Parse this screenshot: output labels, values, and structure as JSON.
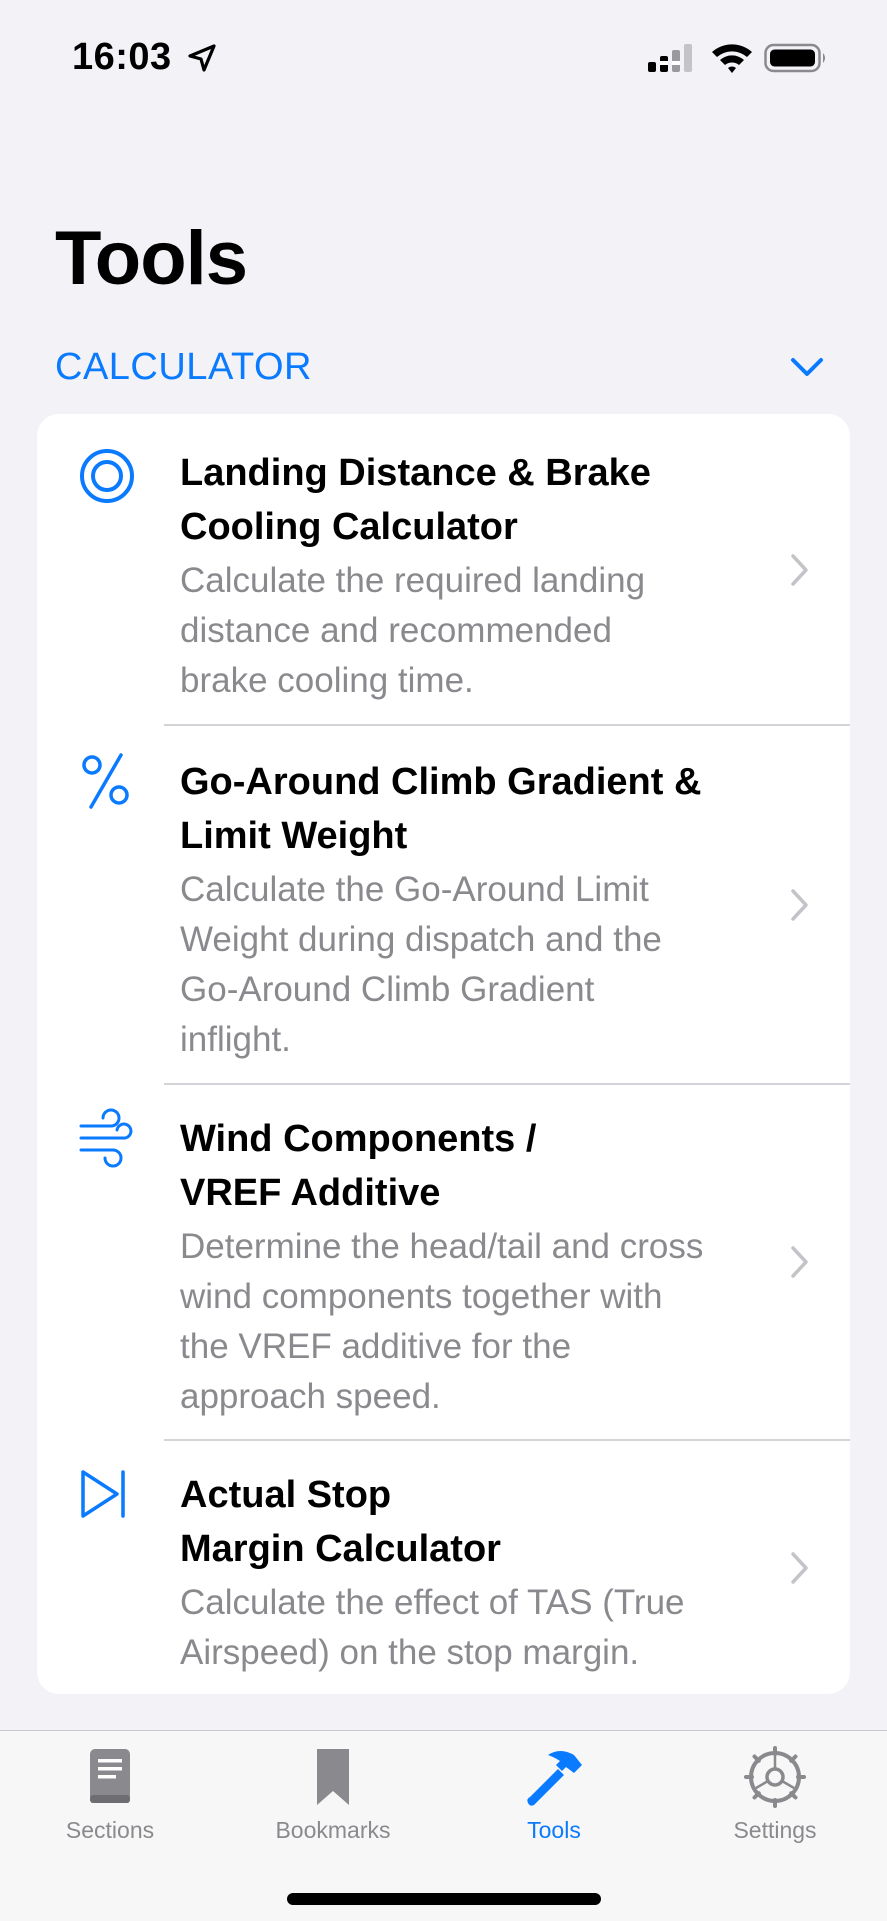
{
  "status_bar": {
    "time": "16:03"
  },
  "page": {
    "title": "Tools"
  },
  "section": {
    "title": "CALCULATOR"
  },
  "colors": {
    "accent": "#0a7aff",
    "secondary_text": "#8a8a8e",
    "background": "#f2f2f7"
  },
  "rows": [
    {
      "icon": "target-icon",
      "title_lines": [
        "Landing Distance & Brake",
        "Cooling Calculator"
      ],
      "description_lines": [
        "Calculate the required landing",
        "distance and recommended",
        "brake cooling time."
      ]
    },
    {
      "icon": "percent-icon",
      "title_lines": [
        "Go-Around Climb Gradient &",
        "Limit Weight"
      ],
      "description_lines": [
        "Calculate the Go-Around Limit",
        "Weight during dispatch and the",
        "Go-Around Climb Gradient",
        "inflight."
      ]
    },
    {
      "icon": "wind-icon",
      "title_lines": [
        "Wind Components /",
        "VREF Additive"
      ],
      "description_lines": [
        "Determine the head/tail and cross",
        "wind components together with",
        "the VREF additive for the",
        "approach speed."
      ]
    },
    {
      "icon": "play-end-icon",
      "title_lines": [
        "Actual Stop",
        "Margin Calculator"
      ],
      "description_lines": [
        "Calculate the effect of TAS (True",
        "Airspeed) on the stop margin."
      ]
    }
  ],
  "tab_bar": {
    "tabs": [
      {
        "label": "Sections",
        "icon": "book-icon"
      },
      {
        "label": "Bookmarks",
        "icon": "bookmark-icon"
      },
      {
        "label": "Tools",
        "icon": "hammer-icon",
        "active": true
      },
      {
        "label": "Settings",
        "icon": "gear-icon"
      }
    ]
  }
}
